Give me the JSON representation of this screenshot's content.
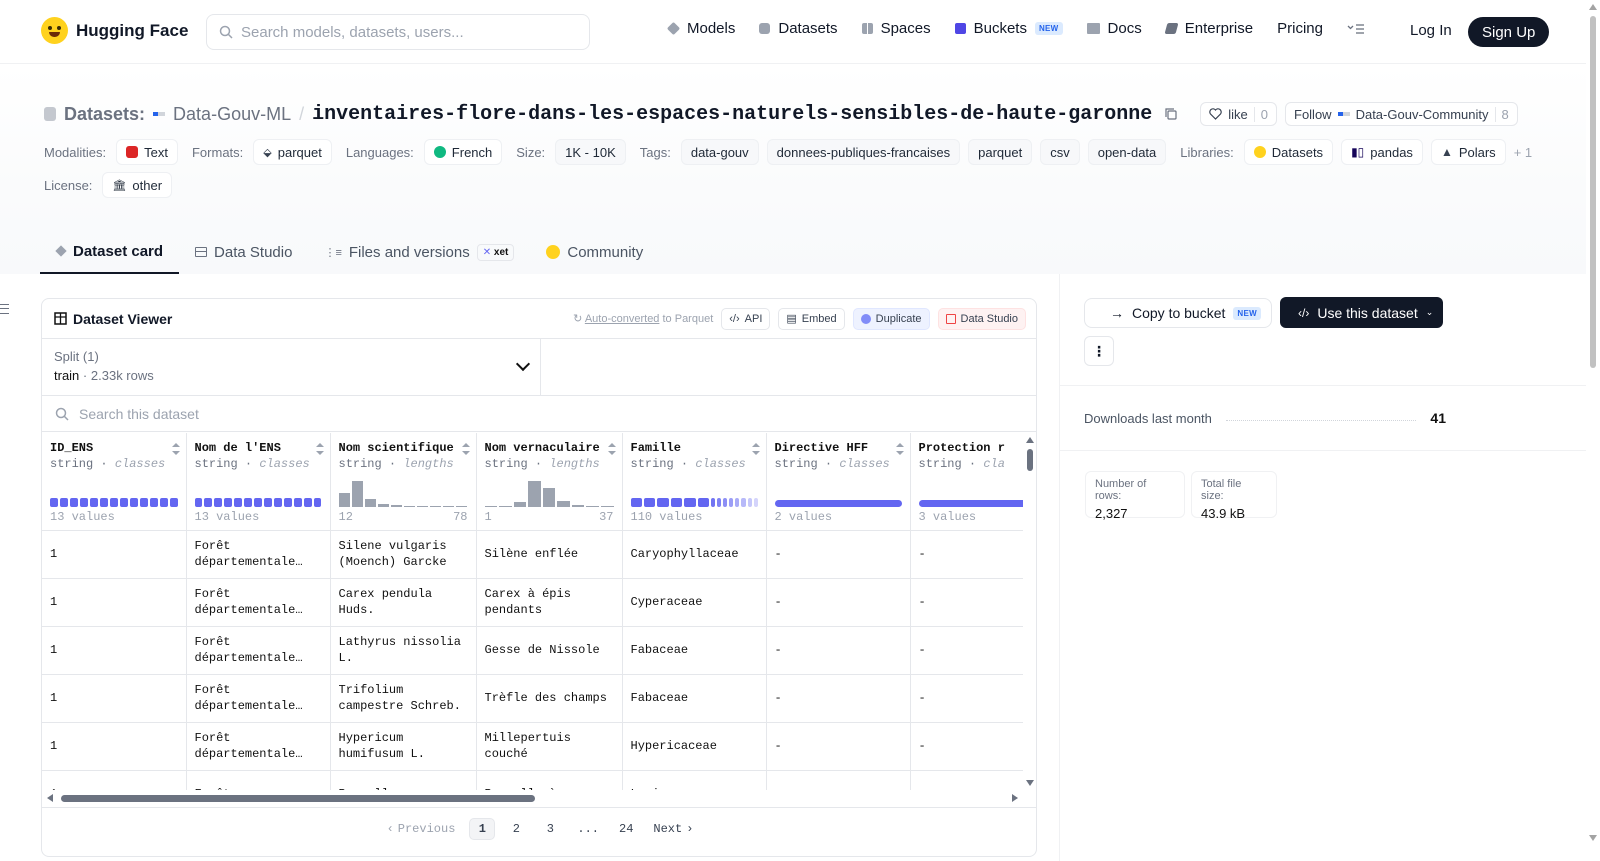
{
  "nav": {
    "brand": "Hugging Face",
    "search_placeholder": "Search models, datasets, users...",
    "links": [
      {
        "label": "Models",
        "icon": "cube-icon"
      },
      {
        "label": "Datasets",
        "icon": "database-icon"
      },
      {
        "label": "Spaces",
        "icon": "grid-icon"
      },
      {
        "label": "Buckets",
        "icon": "bucket-icon",
        "badge": "NEW"
      },
      {
        "label": "Docs",
        "icon": "book-icon"
      },
      {
        "label": "Enterprise",
        "icon": "enterprise-icon"
      },
      {
        "label": "Pricing",
        "icon": ""
      }
    ],
    "login": "Log In",
    "signup": "Sign Up"
  },
  "header": {
    "label": "Datasets:",
    "org": "Data-Gouv-ML",
    "repo": "inventaires-flore-dans-les-espaces-naturels-sensibles-de-haute-garonne",
    "like_label": "like",
    "like_count": "0",
    "follow_label": "Follow",
    "follow_target": "Data-Gouv-Community",
    "follow_count": "8",
    "modalities_label": "Modalities:",
    "modality": "Text",
    "formats_label": "Formats:",
    "format": "parquet",
    "languages_label": "Languages:",
    "language": "French",
    "size_label": "Size:",
    "size": "1K - 10K",
    "tags_label": "Tags:",
    "tags": [
      "data-gouv",
      "donnees-publiques-francaises",
      "parquet",
      "csv",
      "open-data"
    ],
    "libraries_label": "Libraries:",
    "libraries": [
      "Datasets",
      "pandas",
      "Polars"
    ],
    "libraries_more": "+ 1",
    "license_label": "License:",
    "license": "other"
  },
  "tabs": [
    {
      "label": "Dataset card",
      "icon": "cube-icon"
    },
    {
      "label": "Data Studio",
      "icon": "table-icon"
    },
    {
      "label": "Files and versions",
      "icon": "files-icon",
      "badge": "xet"
    },
    {
      "label": "Community",
      "icon": "hf-emoji-icon"
    }
  ],
  "viewer": {
    "title": "Dataset Viewer",
    "auto_converted": "Auto-converted",
    "to_parquet": "to Parquet",
    "api": "API",
    "embed": "Embed",
    "duplicate": "Duplicate",
    "data_studio": "Data Studio",
    "split_label": "Split (1)",
    "split_name": "train",
    "split_sep": "·",
    "split_rows": "2.33k rows",
    "search_placeholder": "Search this dataset",
    "columns": [
      {
        "name": "ID_ENS",
        "type": "string",
        "kind": "classes",
        "viz": "classes",
        "footer_left": "13 values",
        "footer_right": ""
      },
      {
        "name": "Nom de l'ENS",
        "type": "string",
        "kind": "classes",
        "viz": "classes",
        "footer_left": "13 values",
        "footer_right": ""
      },
      {
        "name": "Nom scientifique",
        "type": "string",
        "kind": "lengths",
        "viz": "hist",
        "hist": [
          0.55,
          1.0,
          0.3,
          0.12,
          0.06,
          0.05,
          0.05,
          0.05,
          0.05,
          0.05
        ],
        "footer_left": "12",
        "footer_right": "78"
      },
      {
        "name": "Nom vernaculaire",
        "type": "string",
        "kind": "lengths",
        "viz": "hist",
        "hist": [
          0.05,
          0.05,
          0.2,
          1.0,
          0.75,
          0.25,
          0.08,
          0.05,
          0.05
        ],
        "footer_left": "1",
        "footer_right": "37"
      },
      {
        "name": "Famille",
        "type": "string",
        "kind": "classes",
        "viz": "classes_fade",
        "footer_left": "110 values",
        "footer_right": ""
      },
      {
        "name": "Directive HFF",
        "type": "string",
        "kind": "classes",
        "viz": "full",
        "footer_left": "2 values",
        "footer_right": ""
      },
      {
        "name": "Protection r",
        "type": "string",
        "kind": "cla",
        "viz": "full",
        "footer_left": "3 values",
        "footer_right": ""
      }
    ],
    "rows": [
      [
        "1",
        "Forêt départementale de…",
        "Silene vulgaris (Moench) Garcke",
        "Silène enflée",
        "Caryophyllaceae",
        "-",
        "-"
      ],
      [
        "1",
        "Forêt départementale de…",
        "Carex pendula Huds.",
        "Carex à épis pendants",
        "Cyperaceae",
        "-",
        "-"
      ],
      [
        "1",
        "Forêt départementale de…",
        "Lathyrus nissolia L.",
        "Gesse de Nissole",
        "Fabaceae",
        "-",
        "-"
      ],
      [
        "1",
        "Forêt départementale de…",
        "Trifolium campestre Schreb.",
        "Trèfle des champs",
        "Fabaceae",
        "-",
        "-"
      ],
      [
        "1",
        "Forêt départementale de…",
        "Hypericum humifusum L.",
        "Millepertuis couché",
        "Hypericaceae",
        "-",
        "-"
      ],
      [
        "1",
        "Forêt",
        "Prunella",
        "Prunelle à",
        "Lamiaceae",
        "-",
        "-"
      ]
    ],
    "pager": {
      "previous": "Previous",
      "pages": [
        "1",
        "2",
        "3",
        "...",
        "24"
      ],
      "current": "1",
      "next": "Next"
    }
  },
  "sidebar": {
    "copy_to_bucket": "Copy to bucket",
    "copy_badge": "NEW",
    "use_dataset": "Use this dataset",
    "downloads_label": "Downloads last month",
    "downloads_value": "41",
    "rows_label": "Number of rows:",
    "rows_value": "2,327",
    "size_label": "Total file size:",
    "size_value": "43.9 kB"
  },
  "colors": {
    "accent": "#6366f1",
    "dark": "#111827",
    "brand_yellow": "#ffd21e"
  }
}
